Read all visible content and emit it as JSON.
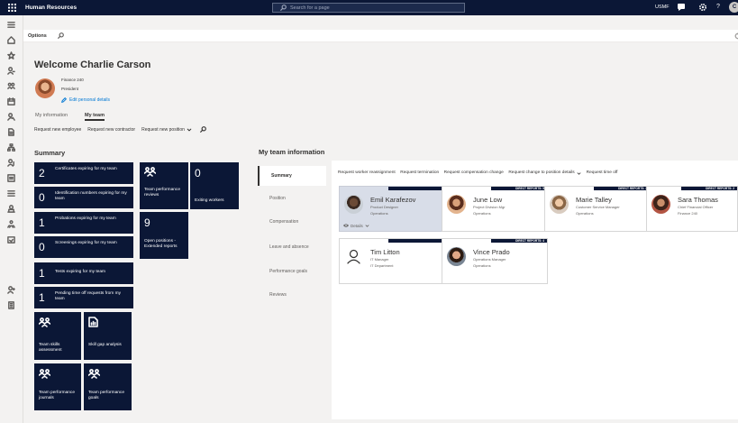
{
  "topbar": {
    "app_title": "Human Resources",
    "search_placeholder": "Search for a page",
    "company": "USMF"
  },
  "actionbar": {
    "options_label": "Options"
  },
  "profile": {
    "welcome": "Welcome Charlie Carson",
    "legal_entity": "Finance 240",
    "job_title": "President",
    "edit_link": "Edit personal details"
  },
  "tabs": [
    {
      "label": "My information"
    },
    {
      "label": "My team"
    }
  ],
  "commands": {
    "new_employee": "Request new employee",
    "new_contractor": "Request new contractor",
    "new_position": "Request new position"
  },
  "summary": {
    "title": "Summary",
    "tiles": [
      {
        "count": "2",
        "label": "Certificates expiring for my team"
      },
      {
        "count": "0",
        "label": "Identification numbers expiring for my team"
      },
      {
        "count": "1",
        "label": "Probations expiring for my team"
      },
      {
        "count": "0",
        "label": "Screenings expiring for my team"
      },
      {
        "count": "1",
        "label": "Tests expiring for my team"
      },
      {
        "count": "1",
        "label": "Pending time off requests from my team"
      },
      {
        "label": "Team performance reviews",
        "icon": "people-icon"
      },
      {
        "count": "0",
        "label": "Exiting workers"
      },
      {
        "count": "9",
        "label": "Open positions - Extended reports"
      },
      {
        "label": "Team skills assessment",
        "icon": "people-icon"
      },
      {
        "label": "Skill gap analysis",
        "icon": "report-icon"
      },
      {
        "label": "Team performance journals",
        "icon": "people-icon"
      },
      {
        "label": "Team performance goals",
        "icon": "people-icon"
      }
    ]
  },
  "team": {
    "title": "My team information",
    "vtabs": [
      "Summary",
      "Position",
      "Compensation",
      "Leave and absence",
      "Performance goals",
      "Reviews"
    ],
    "commands": [
      "Request worker reassignment",
      "Request termination",
      "Request compensation change",
      "Request change to position details",
      "Request time off"
    ],
    "details_label": "Details",
    "members": [
      {
        "name": "Emil Karafezov",
        "title": "Product Designer",
        "department": "Operations",
        "badge": ""
      },
      {
        "name": "June Low",
        "title": "Project Division Mgr",
        "department": "Operations",
        "badge": "DIRECT REPORTS: 5"
      },
      {
        "name": "Marie Talley",
        "title": "Customer Service Manager",
        "department": "Operations",
        "badge": "DIRECT REPORTS: 3"
      },
      {
        "name": "Sara Thomas",
        "title": "Chief Financial Officer",
        "department": "Finance 240",
        "badge": "DIRECT REPORTS: 2"
      },
      {
        "name": "Tim Litton",
        "title": "IT Manager",
        "department": "IT Department",
        "badge": ""
      },
      {
        "name": "Vince Prado",
        "title": "Operations Manager",
        "department": "Operations",
        "badge": "DIRECT REPORTS: 4"
      }
    ]
  }
}
